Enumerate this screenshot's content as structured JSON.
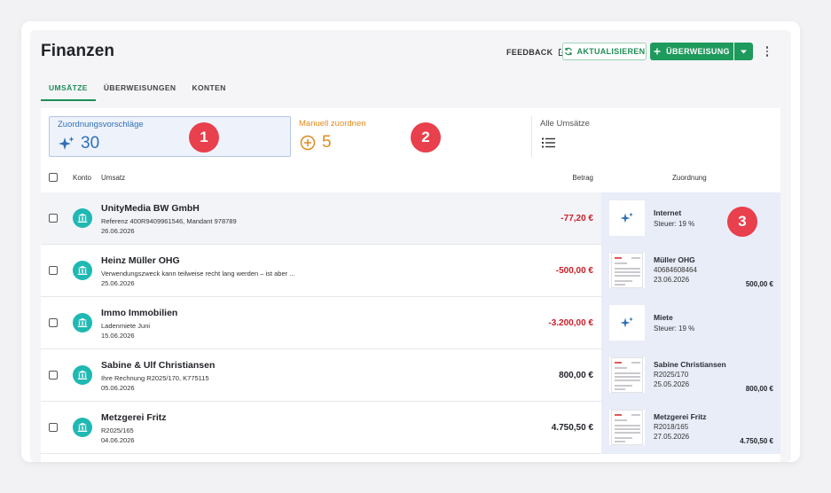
{
  "title": "Finanzen",
  "toolbar": {
    "feedback_label": "FEEDBACK",
    "refresh_label": "AKTUALISIEREN",
    "transfer_label": "ÜBERWEISUNG",
    "primary_color": "#1e9a5c"
  },
  "tabs": [
    {
      "label": "UMSÄTZE",
      "active": true
    },
    {
      "label": "ÜBERWEISUNGEN",
      "active": false
    },
    {
      "label": "KONTEN",
      "active": false
    }
  ],
  "stats": [
    {
      "label": "Zuordnungsvorschläge",
      "value": "30",
      "icon": "sparkle-icon",
      "color": "#2f6fb8",
      "marker": "1"
    },
    {
      "label": "Manuell zuordnen",
      "value": "5",
      "icon": "plus-circle-icon",
      "color": "#e08a1e",
      "marker": "2"
    },
    {
      "label": "Alle Umsätze",
      "value": "",
      "icon": "list-icon",
      "color": "#444444"
    }
  ],
  "table": {
    "headers": {
      "konto": "Konto",
      "umsatz": "Umsatz",
      "betrag": "Betrag",
      "zuordnung": "Zuordnung"
    },
    "rows": [
      {
        "name": "UnityMedia BW GmbH",
        "ref": "Referenz 400R9409961546, Mandant 978789",
        "date": "26.06.2026",
        "amount": "-77,20 €",
        "negative": true,
        "assign": {
          "type": "suggestion",
          "title": "Internet",
          "lines": [
            "Steuer:  19 %"
          ],
          "amount": ""
        }
      },
      {
        "name": "Heinz Müller OHG",
        "ref": "Verwendungszweck kann teilweise recht lang werden – ist aber ...",
        "date": "25.06.2026",
        "amount": "-500,00 €",
        "negative": true,
        "assign": {
          "type": "document",
          "title": "Müller OHG",
          "lines": [
            "40684608464",
            "23.06.2026"
          ],
          "amount": "500,00 €"
        }
      },
      {
        "name": "Immo Immobilien",
        "ref": "Ladenmiete Juni",
        "date": "15.06.2026",
        "amount": "-3.200,00 €",
        "negative": true,
        "assign": {
          "type": "suggestion",
          "title": "Miete",
          "lines": [
            "Steuer:  19 %"
          ],
          "amount": ""
        }
      },
      {
        "name": "Sabine & Ulf Christiansen",
        "ref": "Ihre Rechnung R2025/170, K775115",
        "date": "05.06.2026",
        "amount": "800,00 €",
        "negative": false,
        "assign": {
          "type": "document",
          "title": "Sabine Christiansen",
          "lines": [
            "R2025/170",
            "25.05.2026"
          ],
          "amount": "800,00 €"
        }
      },
      {
        "name": "Metzgerei Fritz",
        "ref": "R2025/165",
        "date": "04.06.2026",
        "amount": "4.750,50 €",
        "negative": false,
        "assign": {
          "type": "document",
          "title": "Metzgerei Fritz",
          "lines": [
            "R2018/165",
            "27.05.2026"
          ],
          "amount": "4.750,50 €"
        }
      }
    ]
  },
  "annotation_marker_3": "3",
  "colors": {
    "negative": "#cc1f2a",
    "bank": "#1fb8b3",
    "marker": "#e8404c",
    "assign_bg": "#e9edf8"
  }
}
